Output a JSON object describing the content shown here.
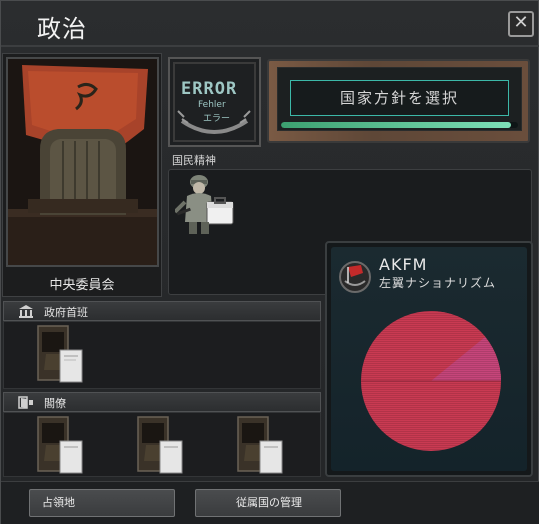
{
  "window": {
    "title": "政治",
    "close_label": "✕"
  },
  "leader": {
    "name": "中央委員会"
  },
  "ideology": {
    "main_text": "ERROR",
    "sub_text_1": "Fehler",
    "sub_text_2": "エラー"
  },
  "national_focus": {
    "button_label": "国家方針を選択",
    "progress": 0.97
  },
  "national_spirits": {
    "label": "国民精神",
    "items": [
      {
        "icon": "soldier-with-briefcase-icon"
      }
    ]
  },
  "party": {
    "abbreviation": "AKFM",
    "ideology": "左翼ナショナリズム",
    "emblem_icon": "red-flag-icon",
    "support_colors": [
      "#c93a52",
      "#c6457a"
    ]
  },
  "cabinet": {
    "head_of_government_label": "政府首班",
    "ministers_label": "閣僚"
  },
  "buttons": {
    "occupied": "占領地",
    "subjects": "従属国の管理"
  }
}
